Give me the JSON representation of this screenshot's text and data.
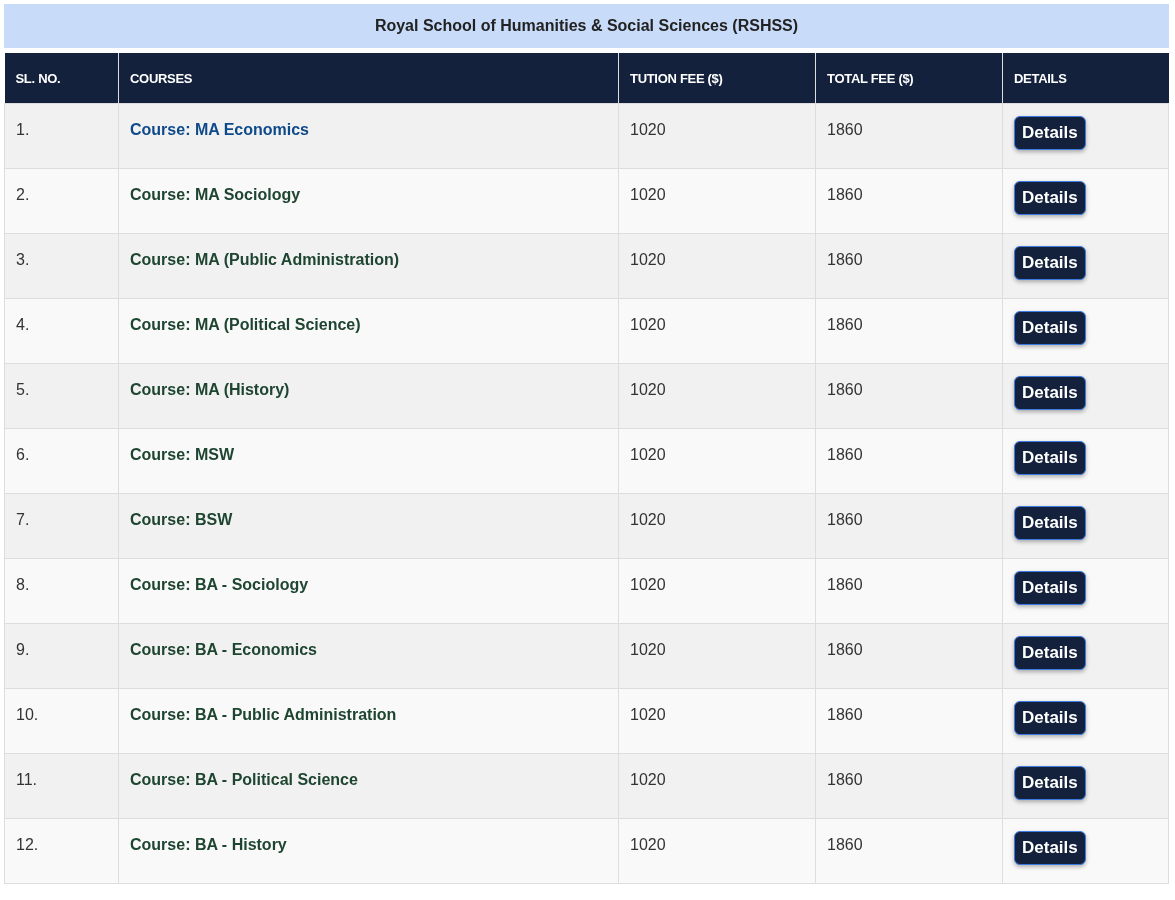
{
  "title": "Royal School of Humanities & Social Sciences (RSHSS)",
  "columns": [
    "SL. NO.",
    "COURSES",
    "TUTION FEE ($)",
    "TOTAL FEE ($)",
    "DETAILS"
  ],
  "rows": [
    {
      "sl": "1.",
      "course": "Course: MA Economics",
      "highlighted": true,
      "tuition": "1020",
      "total": "1860",
      "button": "Details"
    },
    {
      "sl": "2.",
      "course": "Course: MA Sociology",
      "highlighted": false,
      "tuition": "1020",
      "total": "1860",
      "button": "Details"
    },
    {
      "sl": "3.",
      "course": "Course: MA (Public Administration)",
      "highlighted": false,
      "tuition": "1020",
      "total": "1860",
      "button": "Details"
    },
    {
      "sl": "4.",
      "course": "Course: MA (Political Science)",
      "highlighted": false,
      "tuition": "1020",
      "total": "1860",
      "button": "Details"
    },
    {
      "sl": "5.",
      "course": "Course: MA (History)",
      "highlighted": false,
      "tuition": "1020",
      "total": "1860",
      "button": "Details"
    },
    {
      "sl": "6.",
      "course": "Course: MSW",
      "highlighted": false,
      "tuition": "1020",
      "total": "1860",
      "button": "Details"
    },
    {
      "sl": "7.",
      "course": "Course: BSW",
      "highlighted": false,
      "tuition": "1020",
      "total": "1860",
      "button": "Details"
    },
    {
      "sl": "8.",
      "course": "Course: BA - Sociology",
      "highlighted": false,
      "tuition": "1020",
      "total": "1860",
      "button": "Details"
    },
    {
      "sl": "9.",
      "course": "Course: BA - Economics",
      "highlighted": false,
      "tuition": "1020",
      "total": "1860",
      "button": "Details"
    },
    {
      "sl": "10.",
      "course": "Course: BA - Public Administration",
      "highlighted": false,
      "tuition": "1020",
      "total": "1860",
      "button": "Details"
    },
    {
      "sl": "11.",
      "course": "Course: BA - Political Science",
      "highlighted": false,
      "tuition": "1020",
      "total": "1860",
      "button": "Details"
    },
    {
      "sl": "12.",
      "course": "Course: BA - History",
      "highlighted": false,
      "tuition": "1020",
      "total": "1860",
      "button": "Details"
    }
  ]
}
